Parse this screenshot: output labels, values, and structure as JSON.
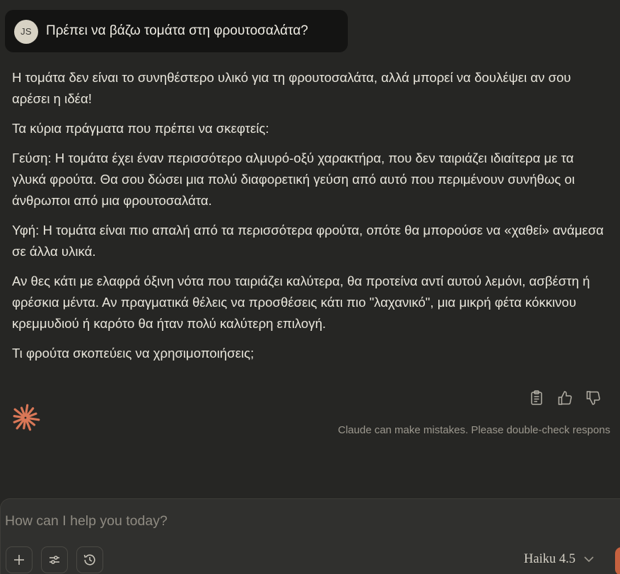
{
  "user_message": {
    "avatar_initials": "JS",
    "text": "Πρέπει να βάζω τομάτα στη φρουτοσαλάτα?"
  },
  "assistant_response": {
    "paragraphs": [
      "Η τομάτα δεν είναι το συνηθέστερο υλικό για τη φρουτοσαλάτα, αλλά μπορεί να δουλέψει αν σου αρέσει η ιδέα!",
      "Τα κύρια πράγματα που πρέπει να σκεφτείς:",
      "Γεύση: Η τομάτα έχει έναν περισσότερο αλμυρό-οξύ χαρακτήρα, που δεν ταιριάζει ιδιαίτερα με τα γλυκά φρούτα. Θα σου δώσει μια πολύ διαφορετική γεύση από αυτό που περιμένουν συνήθως οι άνθρωποι από μια φρουτοσαλάτα.",
      "Υφή: Η τομάτα είναι πιο απαλή από τα περισσότερα φρούτα, οπότε θα μπορούσε να «χαθεί» ανάμεσα σε άλλα υλικά.",
      "Αν θες κάτι με ελαφρά όξινη νότα που ταιριάζει καλύτερα, θα προτείνα αντί αυτού λεμόνι, ασβέστη ή φρέσκια μέντα. Αν πραγματικά θέλεις να προσθέσεις κάτι πιο \"λαχανικό\", μια μικρή φέτα κόκκινου κρεμμυδιού ή καρότο θα ήταν πολύ καλύτερη επιλογή.",
      "Τι φρούτα σκοπεύεις να χρησιμοποιήσεις;"
    ],
    "action_icons": [
      "copy-icon",
      "thumbs-up-icon",
      "thumbs-down-icon"
    ]
  },
  "disclaimer": "Claude can make mistakes. Please double-check respons",
  "composer": {
    "placeholder": "How can I help you today?",
    "tool_icons": [
      "plus-icon",
      "sliders-icon",
      "clock-icon"
    ],
    "model_label": "Haiku 4.5"
  },
  "colors": {
    "background": "#262624",
    "user_bubble": "#141413",
    "composer": "#30302e",
    "accent": "#d97757",
    "send_button": "#c6613f"
  }
}
